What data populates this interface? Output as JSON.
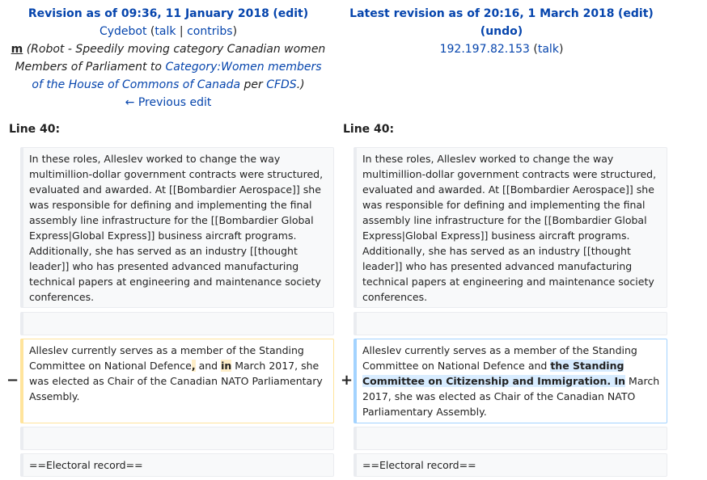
{
  "left_header": {
    "title_prefix": "Revision as of 09:36, 11 January 2018",
    "edit": "edit",
    "user": "Cydebot",
    "talk": "talk",
    "contribs": "contribs",
    "minor": "m",
    "summary_1": "(Robot - Speedily moving category Canadian women Members of Parliament to ",
    "summary_link": "Category:Women members of the House of Commons of Canada",
    "summary_per": " per ",
    "summary_cfds": "CFDS",
    "summary_end": ".)",
    "prev": "← Previous edit"
  },
  "right_header": {
    "title_prefix": "Latest revision as of 20:16, 1 March 2018",
    "edit": "edit",
    "undo": "undo",
    "user": "192.197.82.153",
    "talk": "talk"
  },
  "line_label": "Line 40:",
  "context_paragraph": "In these roles, Alleslev worked to change the way multimillion-dollar government contracts were structured, evaluated and awarded. At [[Bombardier Aerospace]] she was responsible for defining and implementing the final assembly line infrastructure for the [[Bombardier Global Express|Global Express]] business aircraft programs. Additionally, she has served as an industry [[thought leader]] who has presented advanced manufacturing technical papers at engineering and maintenance society conferences.",
  "deleted": {
    "marker": "−",
    "part1": "Alleslev currently serves as a member of the Standing Committee on National Defence",
    "chg1": ",",
    "part2": " and ",
    "chg2": "in",
    "part3": " March 2017, she was elected as Chair of the Canadian NATO Parliamentary Assembly."
  },
  "added": {
    "marker": "+",
    "part1": "Alleslev currently serves as a member of the Standing Committee on National Defence and ",
    "chg1": "the Standing Committee on Citizenship and Immigration. In",
    "part2": " March 2017, she was elected as Chair of the Canadian NATO Parliamentary Assembly."
  },
  "electoral": "==Electoral record=="
}
